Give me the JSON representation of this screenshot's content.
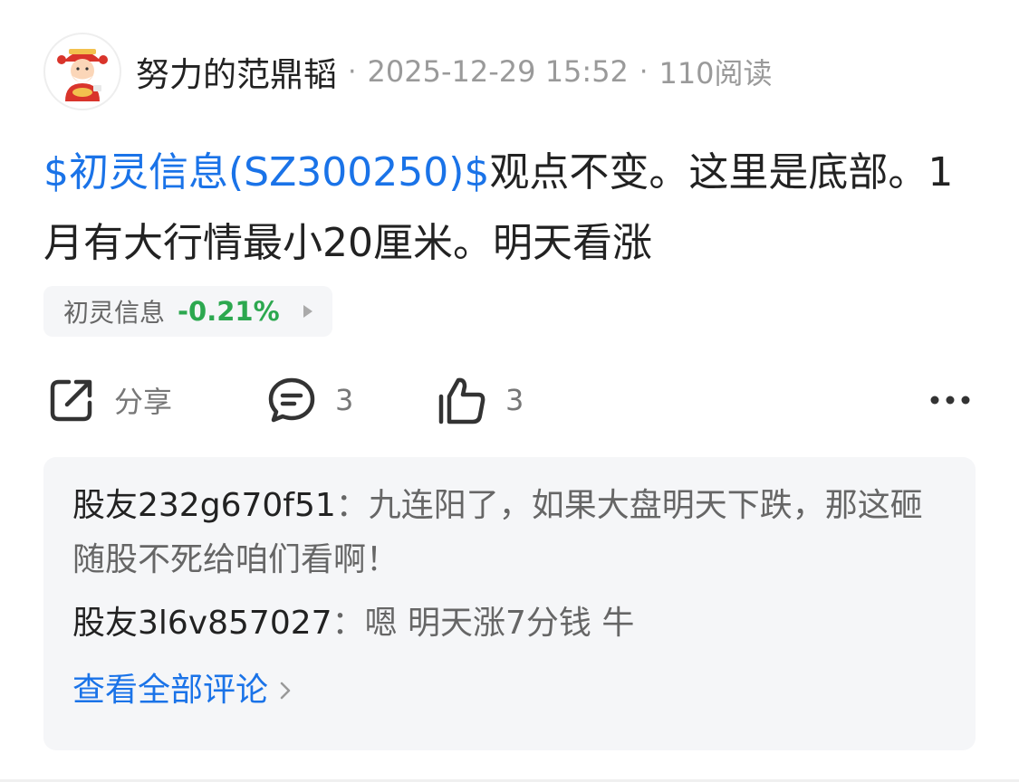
{
  "post": {
    "author": "努力的范鼎韬",
    "separator": "·",
    "timestamp": "2025-12-29 15:52",
    "reads": "110阅读",
    "stock_link": "$初灵信息(SZ300250)$",
    "text": "观点不变。这里是底部。1月有大行情最小20厘米。明天看涨"
  },
  "stock_chip": {
    "name": "初灵信息",
    "change": "-0.21%",
    "change_color": "#2ca84f"
  },
  "actions": {
    "share_label": "分享",
    "comment_count": "3",
    "like_count": "3"
  },
  "comments": [
    {
      "user": "股友232g670f51",
      "sep": "：",
      "text": "九连阳了，如果大盘明天下跌，那这砸随股不死给咱们看啊！"
    },
    {
      "user": "股友3l6v857027",
      "sep": "：",
      "text": "嗯 明天涨7分钱 牛"
    }
  ],
  "view_all_label": "查看全部评论",
  "colors": {
    "link": "#1a73e8",
    "text": "#222222",
    "muted": "#9a9a9a",
    "panel": "#f5f6f8"
  }
}
